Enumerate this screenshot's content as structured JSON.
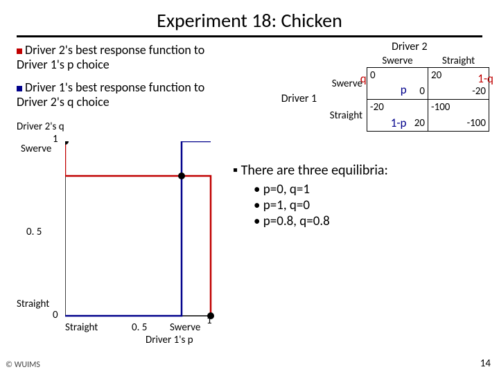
{
  "title": "Experiment 18: Chicken",
  "left": {
    "br2": "Driver 2's best response function to Driver 1's p choice",
    "br1": "Driver 1's best response function to Driver 2's q choice"
  },
  "chart": {
    "ylabel": "Driver 2's q",
    "y1": "1",
    "ySwerve": "Swerve",
    "y05": "0. 5",
    "y0": "0",
    "yStraight": "Straight",
    "xStraight": "Straight",
    "x05": "0. 5",
    "xSwerve": "Swerve",
    "x1": "1",
    "xlabel": "Driver 1's p"
  },
  "matrix": {
    "d2": "Driver 2",
    "d1": "Driver 1",
    "colSwerve": "Swerve",
    "colStraight": "Straight",
    "rowSwerve": "Swerve",
    "rowStraight": "Straight",
    "q": "q",
    "oneq": "1-q",
    "p": "p",
    "onep": "1-p",
    "cells": {
      "ss_tl": "0",
      "ss_br": "0",
      "st_tl": "20",
      "st_br": "-20",
      "ts_tl": "-20",
      "ts_br": "20",
      "tt_tl": "-100",
      "tt_br": "-100"
    }
  },
  "bullets": {
    "lead": "There are three equilibria:",
    "eq1": "p=0, q=1",
    "eq2": "p=1, q=0",
    "eq3": "p=0.8, q=0.8"
  },
  "footer": {
    "left": "© WUIMS",
    "right": "14"
  },
  "chart_data": {
    "type": "line",
    "title": "Best-response functions",
    "xlabel": "Driver 1's p",
    "ylabel": "Driver 2's q",
    "xlim": [
      0,
      1
    ],
    "ylim": [
      0,
      1
    ],
    "series": [
      {
        "name": "Driver 1 best response (blue)",
        "x": [
          0,
          0.8,
          0.8,
          1
        ],
        "y": [
          0,
          0,
          1,
          1
        ]
      },
      {
        "name": "Driver 2 best response (red)",
        "x": [
          0,
          0,
          1,
          1
        ],
        "y": [
          1,
          0.8,
          0.8,
          0
        ]
      }
    ],
    "equilibria": [
      {
        "p": 0,
        "q": 1
      },
      {
        "p": 1,
        "q": 0
      },
      {
        "p": 0.8,
        "q": 0.8
      }
    ]
  }
}
